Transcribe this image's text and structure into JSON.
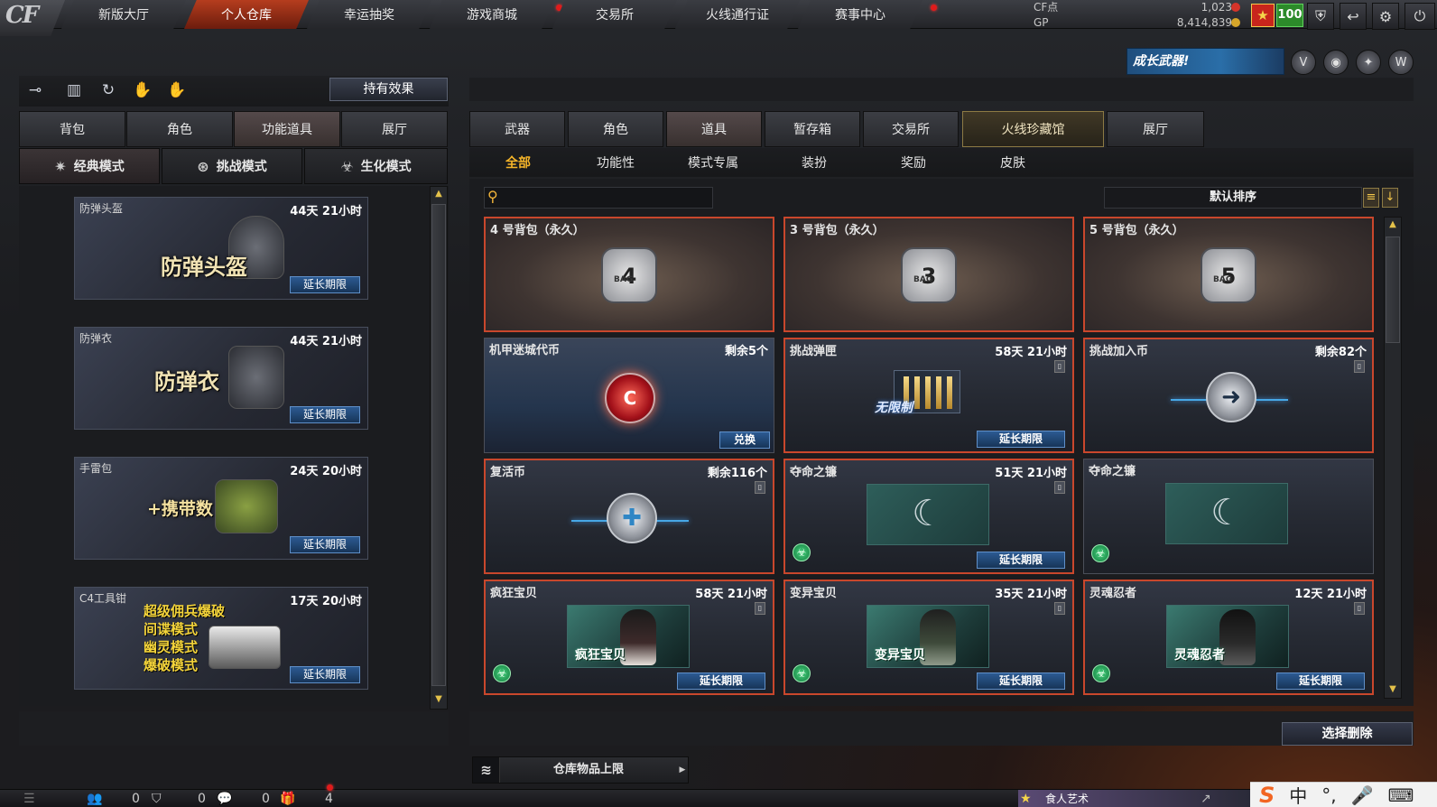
{
  "nav": {
    "logo": "CF",
    "tabs": [
      "新版大厅",
      "个人仓库",
      "幸运抽奖",
      "游戏商城",
      "交易所",
      "火线通行证",
      "赛事中心"
    ],
    "active_tab": "个人仓库",
    "currency": {
      "cf_label": "CF点",
      "cf_value": "1,023",
      "gp_label": "GP",
      "gp_value": "8,414,839",
      "level_badge": "100"
    }
  },
  "banner": {
    "text": "成长武器!"
  },
  "left": {
    "effect_button": "持有效果",
    "tabs": [
      "背包",
      "角色",
      "功能道具",
      "展厅"
    ],
    "active_tab": "功能道具",
    "modes": [
      "经典模式",
      "挑战模式",
      "生化模式"
    ],
    "active_mode": "经典模式",
    "items": [
      {
        "name": "防弹头盔",
        "time": "44天 21小时",
        "art": "防弹头盔",
        "button": "延长期限"
      },
      {
        "name": "防弹衣",
        "time": "44天 21小时",
        "art": "防弹衣",
        "button": "延长期限"
      },
      {
        "name": "手雷包",
        "time": "24天 20小时",
        "art": "+携带数",
        "button": "延长期限"
      },
      {
        "name": "C4工具钳",
        "time": "17天 20小时",
        "art_lines": [
          "超级佣兵爆破",
          "间谍模式",
          "幽灵模式",
          "爆破模式"
        ],
        "button": "延长期限"
      }
    ]
  },
  "right": {
    "tabs": [
      "武器",
      "角色",
      "道具",
      "暂存箱",
      "交易所",
      "火线珍藏馆",
      "展厅"
    ],
    "active_tab": "道具",
    "subtabs": [
      "全部",
      "功能性",
      "模式专属",
      "装扮",
      "奖励",
      "皮肤"
    ],
    "active_subtab": "全部",
    "sort_label": "默认排序",
    "items": [
      {
        "name": "4 号背包（永久）",
        "bag_no": "4",
        "bag_text": "BAG"
      },
      {
        "name": "3 号背包（永久）",
        "bag_no": "3",
        "bag_text": "BAG"
      },
      {
        "name": "5 号背包（永久）",
        "bag_no": "5",
        "bag_text": "BAG"
      },
      {
        "name": "机甲迷城代币",
        "time": "剩余5个",
        "button": "兑换"
      },
      {
        "name": "挑战弹匣",
        "time": "58天 21小时",
        "art": "无限制",
        "button": "延长期限"
      },
      {
        "name": "挑战加入币",
        "time": "剩余82个"
      },
      {
        "name": "复活币",
        "time": "剩余116个"
      },
      {
        "name": "夺命之镰",
        "time": "51天 21小时",
        "button": "延长期限"
      },
      {
        "name": "夺命之镰",
        "time": ""
      },
      {
        "name": "疯狂宝贝",
        "time": "58天 21小时",
        "art": "疯狂宝贝",
        "button": "延长期限"
      },
      {
        "name": "变异宝贝",
        "time": "35天 21小时",
        "art": "变异宝贝",
        "button": "延长期限"
      },
      {
        "name": "灵魂忍者",
        "time": "12天 21小时",
        "art": "灵魂忍者",
        "button": "延长期限"
      }
    ],
    "delete_button": "选择删除",
    "storage_limit": "仓库物品上限"
  },
  "bottom": {
    "counts": [
      "0",
      "0",
      "0",
      "4"
    ],
    "player_name": "食人艺术",
    "ime_label": "中"
  },
  "icon_names": [
    "key-icon",
    "ranking-icon",
    "refresh-icon",
    "hand-icon",
    "mouse-icon",
    "shield-icon",
    "return-icon",
    "gear-icon",
    "power-icon",
    "search-icon",
    "list-icon",
    "sort-down-icon",
    "layers-icon",
    "trash-icon",
    "bio-icon"
  ]
}
